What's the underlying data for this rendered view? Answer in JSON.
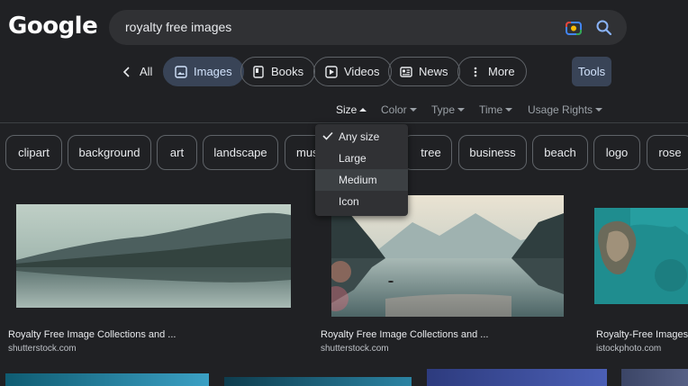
{
  "header": {
    "logo_text": "Google",
    "search_value": "royalty free images"
  },
  "tabs": [
    {
      "label": "All"
    },
    {
      "label": "Images"
    },
    {
      "label": "Books"
    },
    {
      "label": "Videos"
    },
    {
      "label": "News"
    },
    {
      "label": "More"
    }
  ],
  "tools_label": "Tools",
  "filters": [
    "Size",
    "Color",
    "Type",
    "Time",
    "Usage Rights"
  ],
  "chips": [
    "clipart",
    "background",
    "art",
    "landscape",
    "mus",
    "tree",
    "business",
    "beach",
    "logo",
    "rose"
  ],
  "size_dropdown": {
    "items": [
      "Any size",
      "Large",
      "Medium",
      "Icon"
    ],
    "selected": "Any size",
    "hovered": "Medium"
  },
  "results": [
    {
      "title": "Royalty Free Image Collections and ...",
      "source": "shutterstock.com"
    },
    {
      "title": "Royalty Free Image Collections and ...",
      "source": "shutterstock.com"
    },
    {
      "title": "Royalty-Free Images an",
      "source": "istockphoto.com"
    }
  ],
  "colors": {
    "background": "#202124",
    "active_tab": "#394457",
    "search_box": "#303134"
  }
}
